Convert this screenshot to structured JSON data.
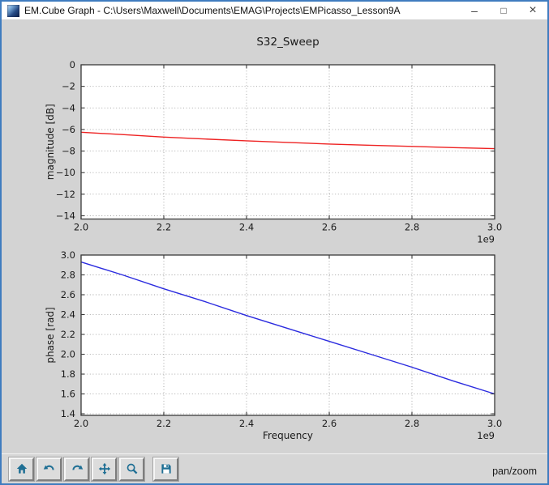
{
  "window": {
    "title": "EM.Cube Graph - C:\\Users\\Maxwell\\Documents\\EMAG\\Projects\\EMPicasso_Lesson9A",
    "minimize_glyph": "–",
    "maximize_glyph": "□",
    "close_glyph": "×"
  },
  "toolbar": {
    "status": "pan/zoom",
    "icon_color": "#1f6f94",
    "buttons": [
      {
        "name": "home",
        "icon": "home-icon"
      },
      {
        "name": "back",
        "icon": "back-icon"
      },
      {
        "name": "forward",
        "icon": "forward-icon"
      },
      {
        "name": "pan",
        "icon": "pan-icon"
      },
      {
        "name": "zoom",
        "icon": "zoom-icon"
      },
      {
        "name": "save",
        "icon": "save-icon"
      }
    ]
  },
  "colors": {
    "window_border": "#3f7cbf",
    "titlebar_bg": "#ffffff",
    "figure_bg": "#d3d3d3",
    "toolbar_bg": "#d6d6d6",
    "axes_bg": "#ffffff",
    "grid": "#a0a0a0",
    "spine": "#3a3a3a",
    "magnitude_line": "#ee2222",
    "phase_line": "#2b2bdf"
  },
  "chart_data": [
    {
      "name": "magnitude",
      "type": "line",
      "title": "S32_Sweep",
      "xlabel": "",
      "ylabel": "magnitude [dB]",
      "x_offset_label": "1e9",
      "line_color": "#ee2222",
      "grid": true,
      "legend": null,
      "xlim": [
        2.0,
        3.0
      ],
      "ylim": [
        -14.3,
        0
      ],
      "xticks": [
        2.0,
        2.2,
        2.4,
        2.6,
        2.8,
        3.0
      ],
      "xtick_labels": [
        "2.0",
        "2.2",
        "2.4",
        "2.6",
        "2.8",
        "3.0"
      ],
      "yticks": [
        0,
        -2,
        -4,
        -6,
        -8,
        -10,
        -12,
        -14
      ],
      "ytick_labels": [
        "0",
        "−2",
        "−4",
        "−6",
        "−8",
        "−10",
        "−12",
        "−14"
      ],
      "x": [
        2.0,
        2.1,
        2.2,
        2.3,
        2.4,
        2.5,
        2.6,
        2.7,
        2.8,
        2.9,
        3.0
      ],
      "y": [
        -6.25,
        -6.47,
        -6.7,
        -6.88,
        -7.05,
        -7.2,
        -7.35,
        -7.46,
        -7.57,
        -7.68,
        -7.78
      ]
    },
    {
      "name": "phase",
      "type": "line",
      "title": "",
      "xlabel": "Frequency",
      "ylabel": "phase [rad]",
      "x_offset_label": "1e9",
      "line_color": "#2b2bdf",
      "grid": true,
      "legend": null,
      "xlim": [
        2.0,
        3.0
      ],
      "ylim": [
        1.384,
        3.0
      ],
      "xticks": [
        2.0,
        2.2,
        2.4,
        2.6,
        2.8,
        3.0
      ],
      "xtick_labels": [
        "2.0",
        "2.2",
        "2.4",
        "2.6",
        "2.8",
        "3.0"
      ],
      "yticks": [
        3.0,
        2.8,
        2.6,
        2.4,
        2.2,
        2.0,
        1.8,
        1.6,
        1.4
      ],
      "ytick_labels": [
        "3.0",
        "2.8",
        "2.6",
        "2.4",
        "2.2",
        "2.0",
        "1.8",
        "1.6",
        "1.4"
      ],
      "x": [
        2.0,
        2.1,
        2.2,
        2.3,
        2.4,
        2.5,
        2.6,
        2.7,
        2.8,
        2.9,
        3.0
      ],
      "y": [
        2.93,
        2.8,
        2.66,
        2.53,
        2.39,
        2.26,
        2.13,
        2.0,
        1.87,
        1.73,
        1.6
      ]
    }
  ]
}
